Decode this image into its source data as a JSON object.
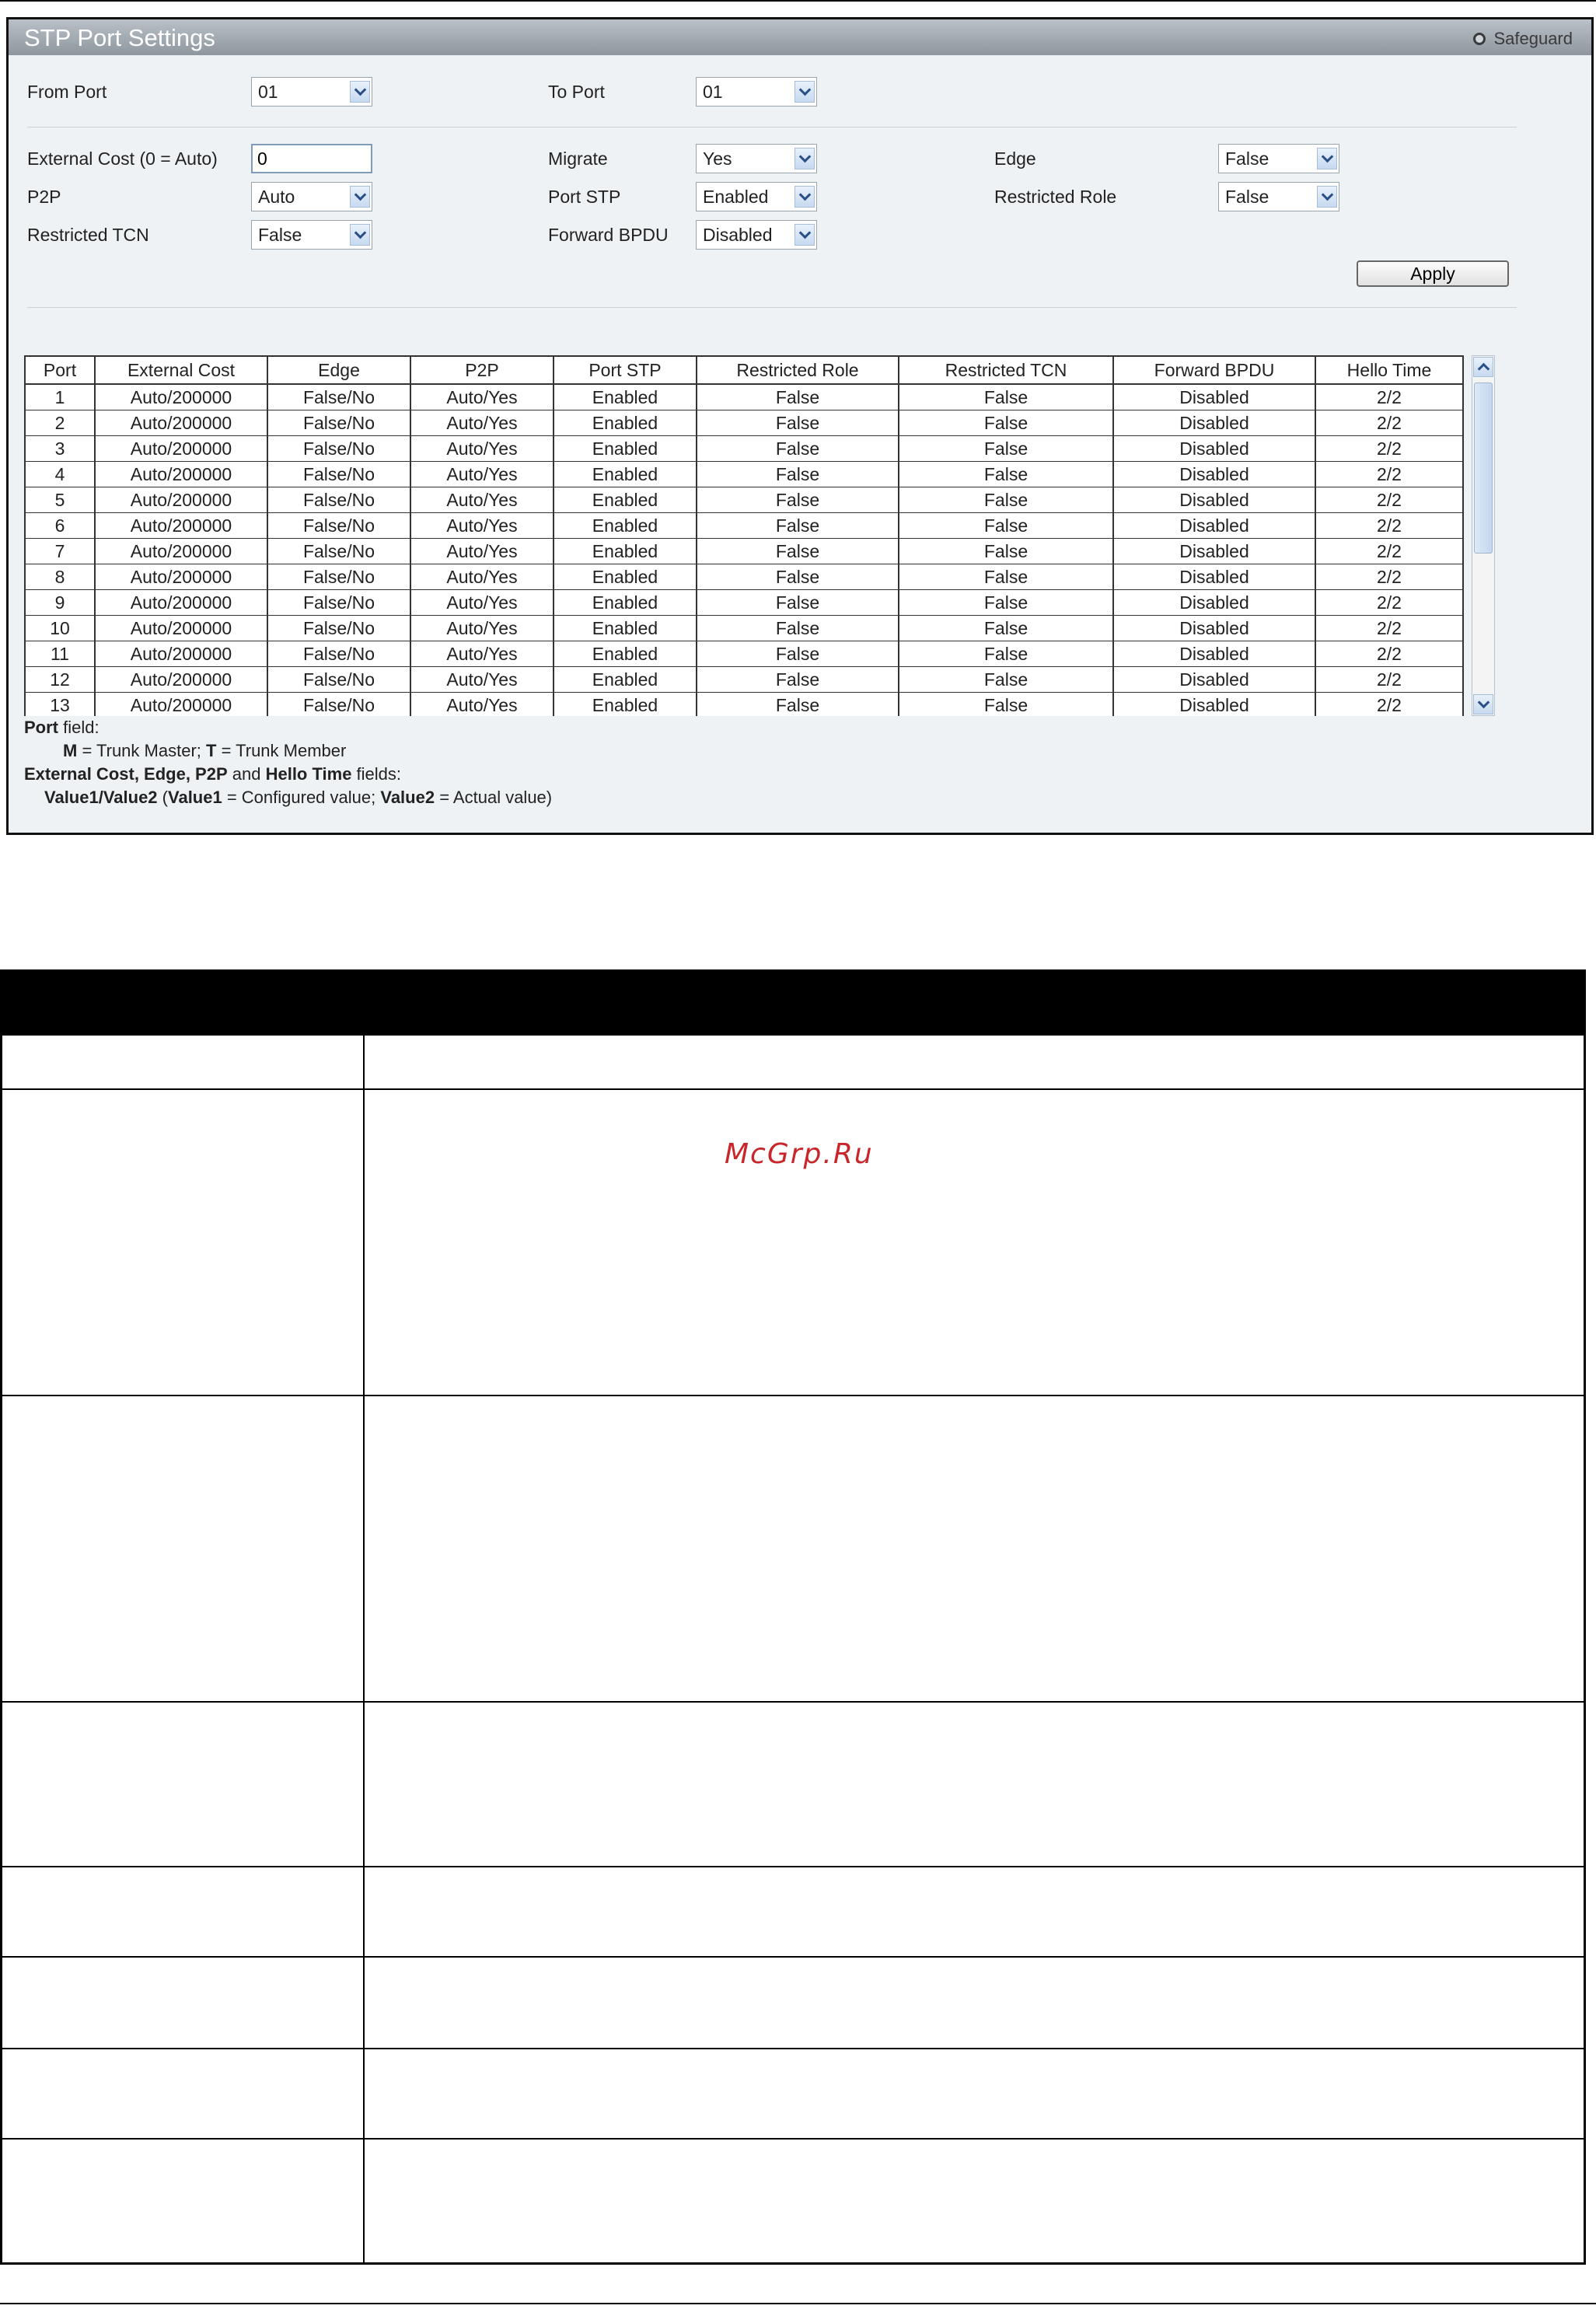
{
  "panel": {
    "title": "STP Port Settings",
    "safeguard": "Safeguard",
    "from_port": {
      "label": "From Port",
      "value": "01"
    },
    "to_port": {
      "label": "To Port",
      "value": "01"
    },
    "external_cost": {
      "label": "External Cost (0 = Auto)",
      "value": "0"
    },
    "migrate": {
      "label": "Migrate",
      "value": "Yes"
    },
    "edge": {
      "label": "Edge",
      "value": "False"
    },
    "p2p": {
      "label": "P2P",
      "value": "Auto"
    },
    "port_stp": {
      "label": "Port STP",
      "value": "Enabled"
    },
    "restricted_role": {
      "label": "Restricted Role",
      "value": "False"
    },
    "restricted_tcn": {
      "label": "Restricted TCN",
      "value": "False"
    },
    "forward_bpdu": {
      "label": "Forward BPDU",
      "value": "Disabled"
    },
    "apply_label": "Apply"
  },
  "table": {
    "columns": [
      "Port",
      "External Cost",
      "Edge",
      "P2P",
      "Port STP",
      "Restricted Role",
      "Restricted TCN",
      "Forward BPDU",
      "Hello Time"
    ],
    "rows": [
      [
        "1",
        "Auto/200000",
        "False/No",
        "Auto/Yes",
        "Enabled",
        "False",
        "False",
        "Disabled",
        "2/2"
      ],
      [
        "2",
        "Auto/200000",
        "False/No",
        "Auto/Yes",
        "Enabled",
        "False",
        "False",
        "Disabled",
        "2/2"
      ],
      [
        "3",
        "Auto/200000",
        "False/No",
        "Auto/Yes",
        "Enabled",
        "False",
        "False",
        "Disabled",
        "2/2"
      ],
      [
        "4",
        "Auto/200000",
        "False/No",
        "Auto/Yes",
        "Enabled",
        "False",
        "False",
        "Disabled",
        "2/2"
      ],
      [
        "5",
        "Auto/200000",
        "False/No",
        "Auto/Yes",
        "Enabled",
        "False",
        "False",
        "Disabled",
        "2/2"
      ],
      [
        "6",
        "Auto/200000",
        "False/No",
        "Auto/Yes",
        "Enabled",
        "False",
        "False",
        "Disabled",
        "2/2"
      ],
      [
        "7",
        "Auto/200000",
        "False/No",
        "Auto/Yes",
        "Enabled",
        "False",
        "False",
        "Disabled",
        "2/2"
      ],
      [
        "8",
        "Auto/200000",
        "False/No",
        "Auto/Yes",
        "Enabled",
        "False",
        "False",
        "Disabled",
        "2/2"
      ],
      [
        "9",
        "Auto/200000",
        "False/No",
        "Auto/Yes",
        "Enabled",
        "False",
        "False",
        "Disabled",
        "2/2"
      ],
      [
        "10",
        "Auto/200000",
        "False/No",
        "Auto/Yes",
        "Enabled",
        "False",
        "False",
        "Disabled",
        "2/2"
      ],
      [
        "11",
        "Auto/200000",
        "False/No",
        "Auto/Yes",
        "Enabled",
        "False",
        "False",
        "Disabled",
        "2/2"
      ],
      [
        "12",
        "Auto/200000",
        "False/No",
        "Auto/Yes",
        "Enabled",
        "False",
        "False",
        "Disabled",
        "2/2"
      ],
      [
        "13",
        "Auto/200000",
        "False/No",
        "Auto/Yes",
        "Enabled",
        "False",
        "False",
        "Disabled",
        "2/2"
      ]
    ]
  },
  "legend": {
    "line1_bold": "Port",
    "line1_rest": " field:",
    "line2_m": "M",
    "line2_a": " = Trunk Master; ",
    "line2_t": "T",
    "line2_b": " = Trunk Member",
    "line3_bold1": "External Cost, Edge, P2P",
    "line3_mid": " and ",
    "line3_bold2": "Hello Time",
    "line3_rest": " fields:",
    "line4_bold1": "Value1/Value2",
    "line4_a": " (",
    "line4_bold2": "Value1",
    "line4_b": " = Configured value; ",
    "line4_bold3": "Value2",
    "line4_c": " = Actual value)"
  },
  "watermark": "McGrp.Ru"
}
